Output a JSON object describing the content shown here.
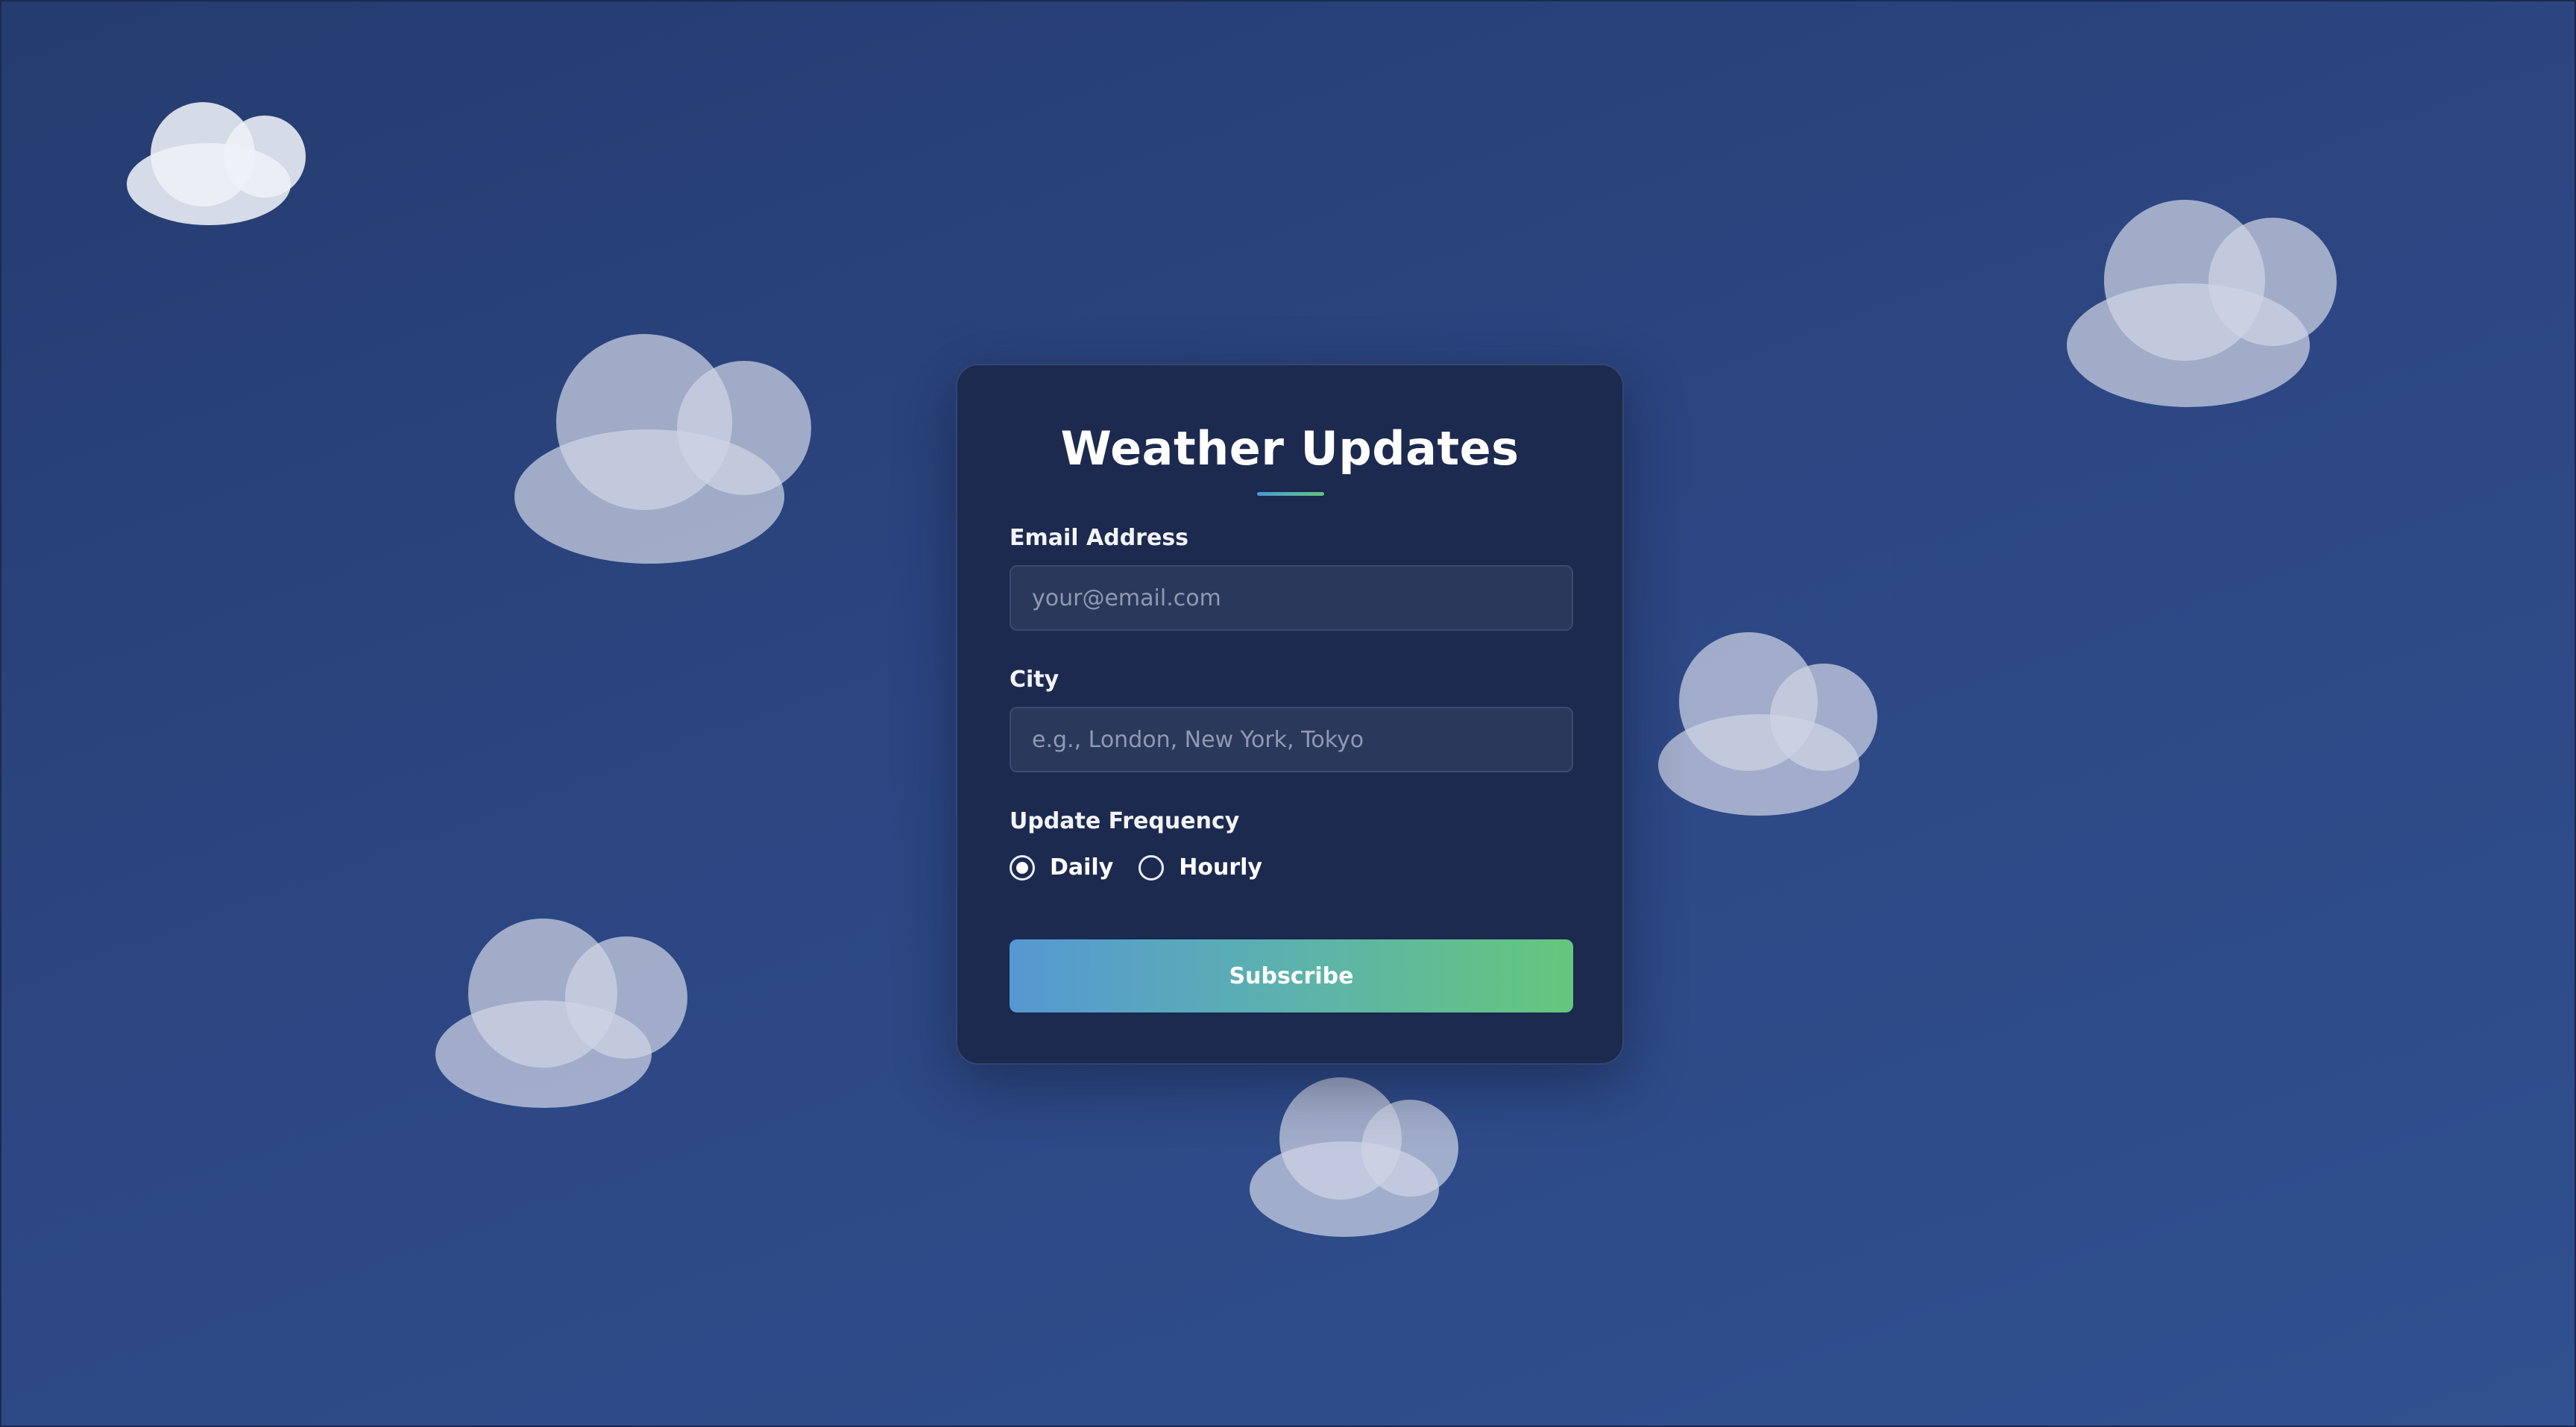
{
  "form": {
    "title": "Weather Updates",
    "email_label": "Email Address",
    "email_placeholder": "your@email.com",
    "email_value": "",
    "city_label": "City",
    "city_placeholder": "e.g., London, New York, Tokyo",
    "city_value": "",
    "frequency_label": "Update Frequency",
    "frequency_options": [
      {
        "label": "Daily",
        "selected": true
      },
      {
        "label": "Hourly",
        "selected": false
      }
    ],
    "subscribe_label": "Subscribe"
  },
  "colors": {
    "background_top": "#253c70",
    "background_bottom": "#30508f",
    "card": "#1c2a4f",
    "input": "#2a385b",
    "accent_start": "#5598d3",
    "accent_end": "#64c77c"
  },
  "decorations": [
    "cloud-icon",
    "cloud-icon",
    "cloud-icon",
    "cloud-icon",
    "cloud-icon",
    "cloud-icon"
  ]
}
